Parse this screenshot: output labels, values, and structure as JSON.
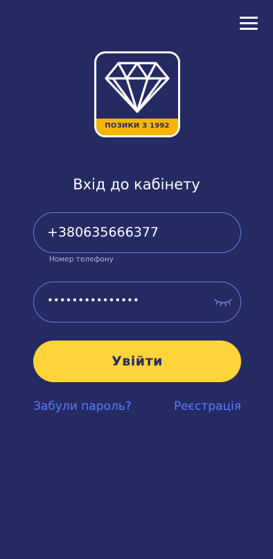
{
  "header": {
    "menu_icon": "hamburger-menu-icon"
  },
  "logo": {
    "icon": "diamond-icon",
    "strip_text": "ПОЗИКИ З 1992",
    "colors": {
      "frame": "#ffffff",
      "strip": "#f7b500"
    }
  },
  "login": {
    "title": "Вхід до кабінету",
    "phone": {
      "value": "+380635666377",
      "caption": "Номер телефону"
    },
    "password": {
      "value": "•••••••••••••••",
      "toggle_icon": "eye-closed-icon"
    },
    "submit_label": "Увійти",
    "forgot_label": "Забули пароль?",
    "register_label": "Реєстрація"
  },
  "colors": {
    "background": "#262a63",
    "accent": "#ffd43b",
    "link": "#5b7cff",
    "field_border": "#6a80e8"
  }
}
